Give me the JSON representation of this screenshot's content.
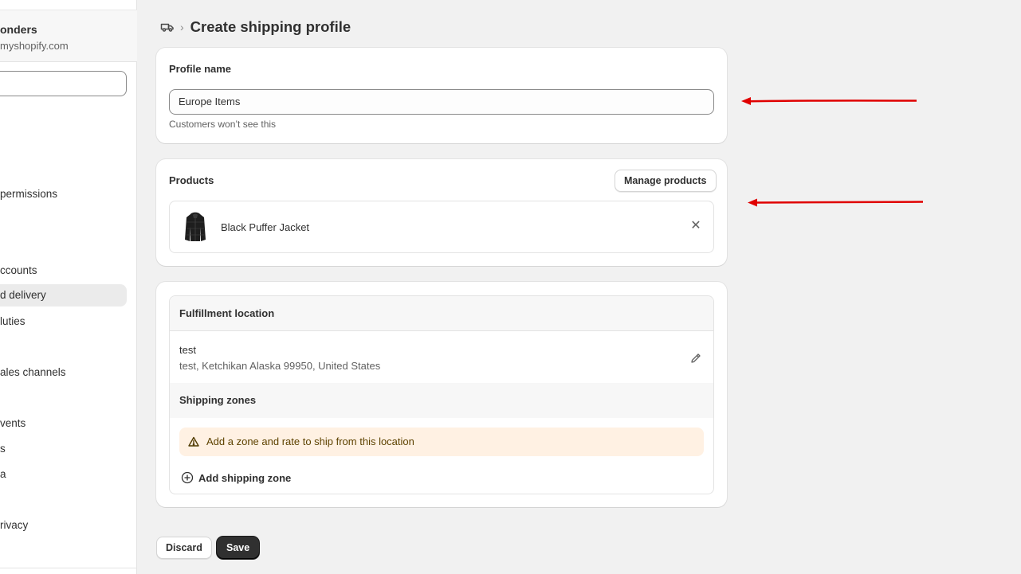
{
  "sidebar": {
    "store_name": "onders",
    "store_domain": "myshopify.com",
    "search_placeholder": "",
    "items": [
      {
        "label": "permissions"
      },
      {
        "label": "ccounts"
      },
      {
        "label": "d delivery"
      },
      {
        "label": "luties"
      },
      {
        "label": "ales channels"
      },
      {
        "label": "vents"
      },
      {
        "label": "s"
      },
      {
        "label": "a"
      },
      {
        "label": "rivacy"
      }
    ]
  },
  "header": {
    "title": "Create shipping profile",
    "icon": "shipping-truck-icon"
  },
  "profile": {
    "heading": "Profile name",
    "value": "Europe Items",
    "help": "Customers won’t see this"
  },
  "products": {
    "heading": "Products",
    "manage_label": "Manage products",
    "items": [
      {
        "name": "Black Puffer Jacket",
        "thumb_icon": "jacket-thumbnail"
      }
    ]
  },
  "fulfillment": {
    "heading": "Fulfillment location",
    "location_name": "test",
    "location_address": "test, Ketchikan Alaska 99950, United States",
    "zones_heading": "Shipping zones",
    "warning_text": "Add a zone and rate to ship from this location",
    "add_zone_label": "Add shipping zone"
  },
  "actions": {
    "discard_label": "Discard",
    "save_label": "Save"
  },
  "colors": {
    "annotation_arrow": "#e00000",
    "primary_button": "#303030",
    "warning_bg": "#fff1e3"
  }
}
